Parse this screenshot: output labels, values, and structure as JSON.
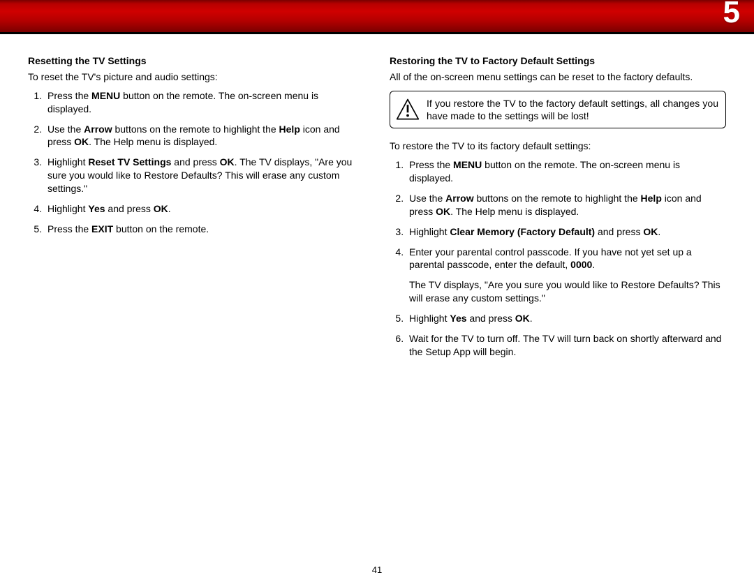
{
  "chapter_number": "5",
  "page_number": "41",
  "left": {
    "heading": "Resetting the TV Settings",
    "intro": "To reset the TV's picture and audio settings:",
    "steps": [
      {
        "pre": "Press the ",
        "b1": "MENU",
        "mid": " button on the remote. The on-screen menu is displayed."
      },
      {
        "pre": "Use the ",
        "b1": "Arrow",
        "mid": " buttons on the remote to highlight the ",
        "b2": "Help",
        "post": " icon and press ",
        "b3": "OK",
        "tail": ". The Help menu is displayed."
      },
      {
        "pre": "Highlight ",
        "b1": "Reset TV Settings",
        "mid": " and press ",
        "b2": "OK",
        "post": ". The TV displays, \"Are you sure you would like to Restore Defaults? This will erase any custom settings.\""
      },
      {
        "pre": "Highlight ",
        "b1": "Yes",
        "mid": " and press ",
        "b2": "OK",
        "post": "."
      },
      {
        "pre": "Press the ",
        "b1": "EXIT",
        "mid": " button on the remote."
      }
    ]
  },
  "right": {
    "heading": "Restoring the TV to Factory Default Settings",
    "intro": "All of the on-screen menu settings can be reset to the factory defaults.",
    "warning": "If you restore the TV to the factory default settings, all changes you have made to the settings will be lost!",
    "intro2": "To restore the TV to its factory default settings:",
    "steps": [
      {
        "pre": "Press the ",
        "b1": "MENU",
        "mid": " button on the remote. The on-screen menu is displayed."
      },
      {
        "pre": "Use the ",
        "b1": "Arrow",
        "mid": " buttons on the remote to highlight the ",
        "b2": "Help",
        "post": " icon and press ",
        "b3": "OK",
        "tail": ". The Help menu is displayed."
      },
      {
        "pre": "Highlight ",
        "b1": "Clear Memory (Factory Default)",
        "mid": " and press ",
        "b2": "OK",
        "post": "."
      },
      {
        "pre": "Enter your parental control passcode. If you have not yet set up a parental passcode, enter the default, ",
        "b1": "0000",
        "mid": ".",
        "para2": "The TV displays, \"Are you sure you would like to Restore Defaults? This will erase any custom settings.\""
      },
      {
        "pre": "Highlight ",
        "b1": "Yes",
        "mid": " and press ",
        "b2": "OK",
        "post": "."
      },
      {
        "pre": "Wait for the TV to turn off. The TV will turn back on shortly afterward and the Setup App will begin."
      }
    ]
  }
}
